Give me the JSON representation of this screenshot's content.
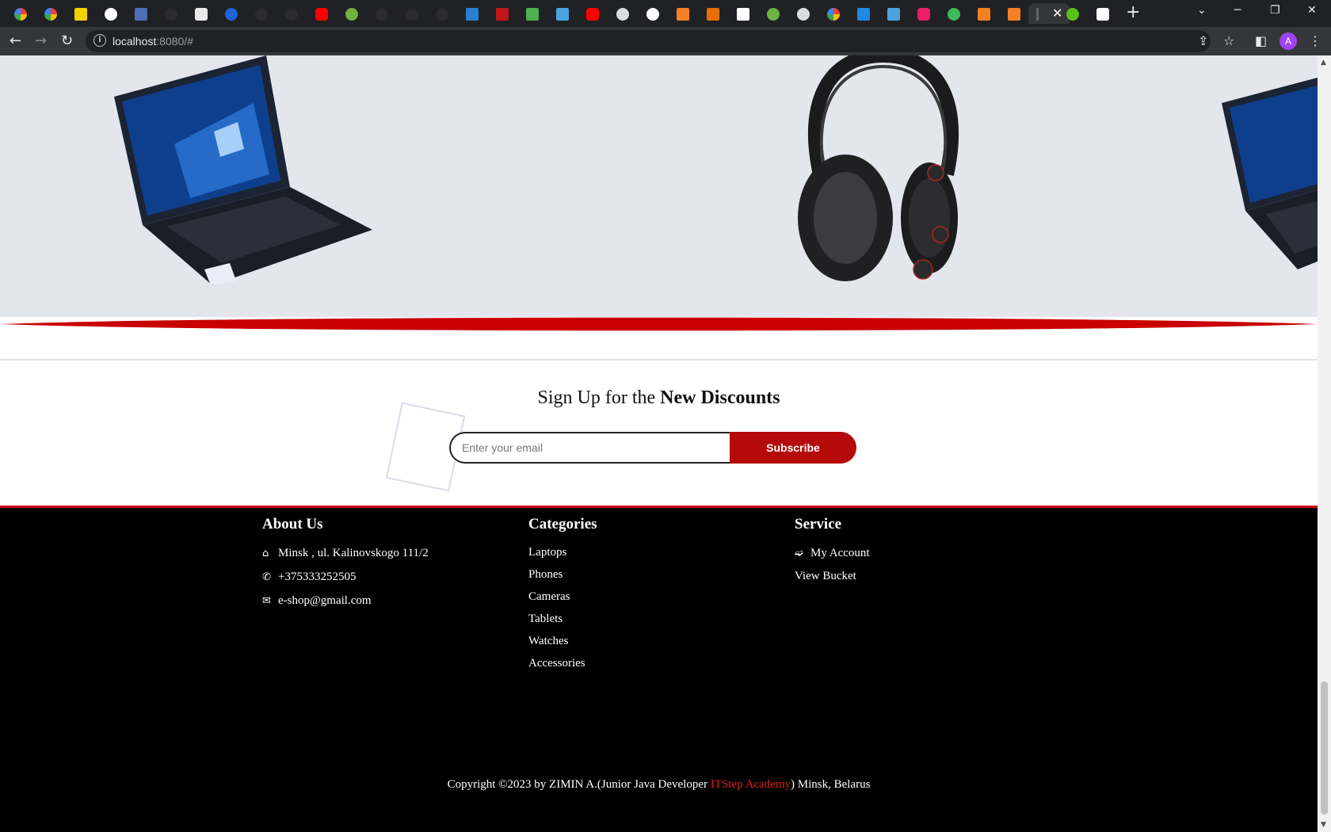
{
  "browser": {
    "tab_close": "✕",
    "new_tab": "+",
    "url_host": "localhost",
    "url_path": ":8080/#",
    "profile_initial": "A"
  },
  "newsletter": {
    "title_plain": "Sign Up for the ",
    "title_bold": "New Discounts",
    "email_placeholder": "Enter your email",
    "subscribe_label": "Subscribe"
  },
  "footer": {
    "about": {
      "heading": "About Us",
      "address": "Minsk , ul. Kalinovskogo 111/2",
      "phone": "+375333252505",
      "email": "e-shop@gmail.com"
    },
    "categories": {
      "heading": "Categories",
      "items": [
        "Laptops",
        "Phones",
        "Cameras",
        "Tablets",
        "Watches",
        "Accessories"
      ]
    },
    "service": {
      "heading": "Service",
      "items": [
        "My Account",
        "View Bucket"
      ]
    },
    "copyright": {
      "before": "Copyright ©2023 by ZIMIN A.(Junior Java Developer ",
      "academy": "ITStep Academy",
      "after": ") Minsk, Belarus"
    }
  },
  "colors": {
    "accent_red": "#b50a0a",
    "footer_border": "#d30a1d",
    "carousel_bg": "#e4e6ee"
  }
}
